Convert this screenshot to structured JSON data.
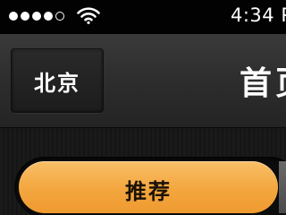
{
  "status_bar": {
    "signal_bars": 4,
    "signal_total": 5,
    "wifi_icon": "wifi-icon",
    "time": "4:34 P"
  },
  "nav_bar": {
    "city_button_label": "北京",
    "title": "首页"
  },
  "tabs": {
    "active_label": "推荐"
  },
  "colors": {
    "accent": "#f3a63e",
    "nav_background": "#2d2d2d",
    "status_background": "#020202"
  }
}
